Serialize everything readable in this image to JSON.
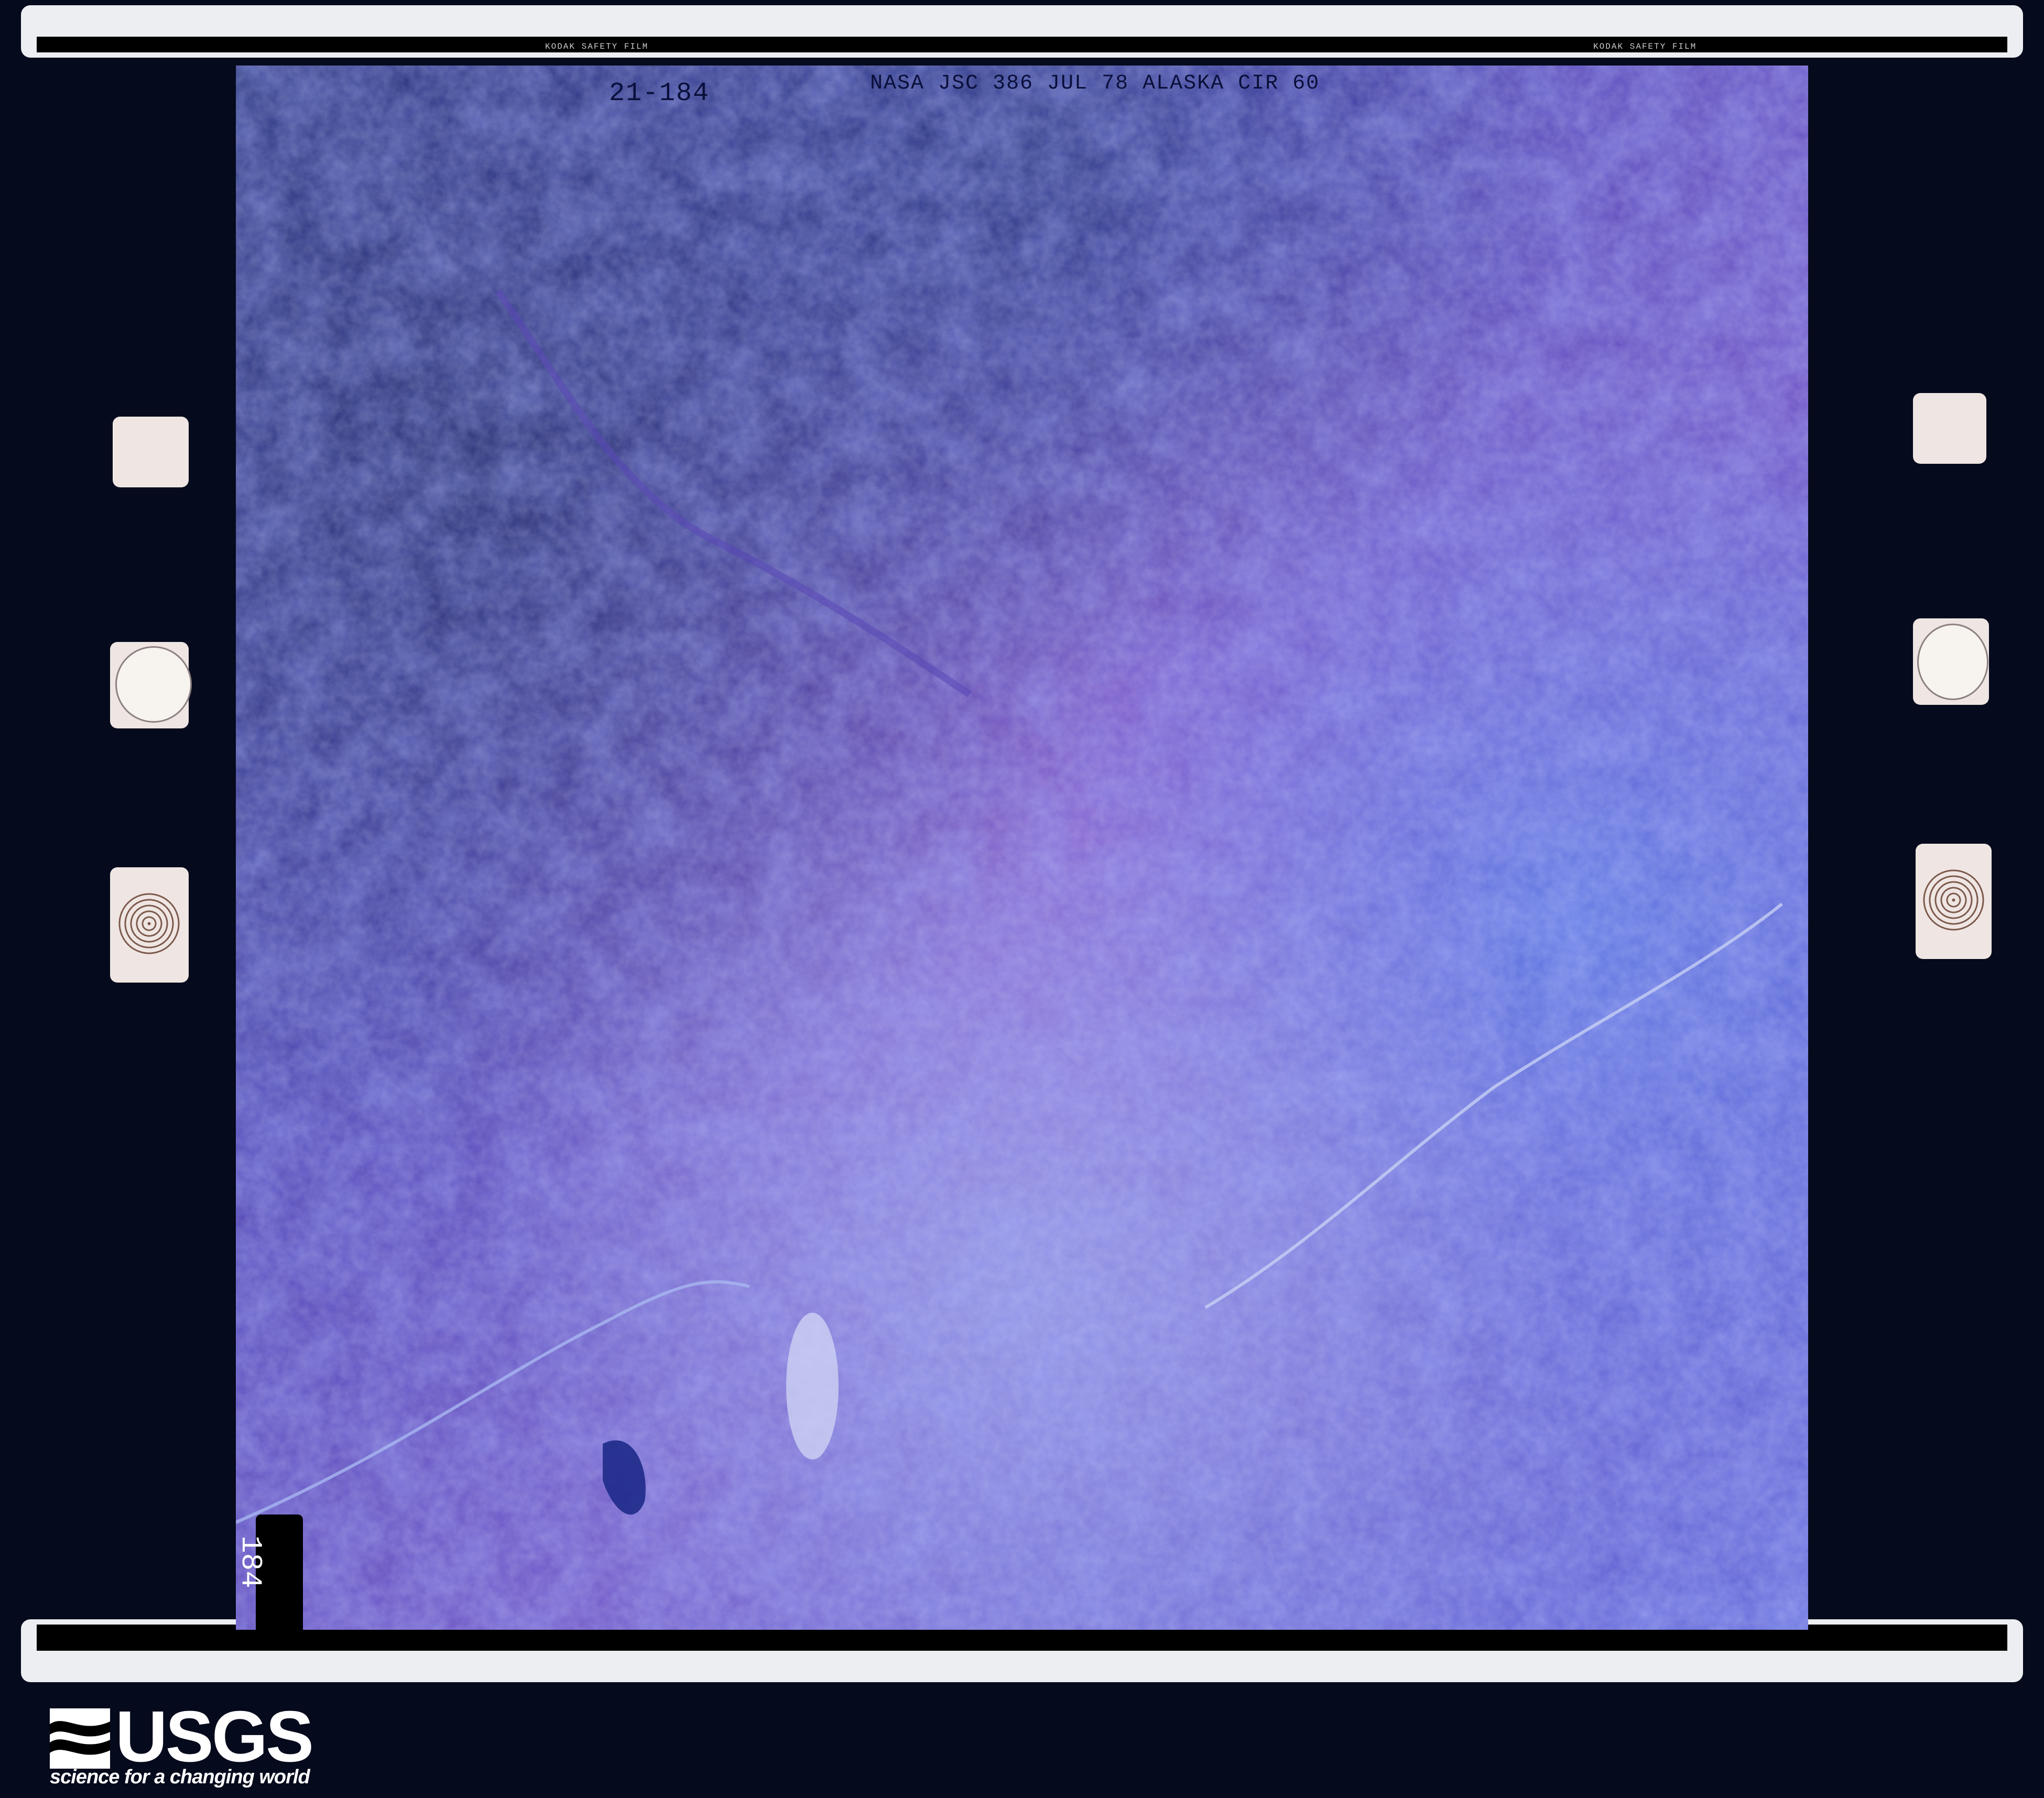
{
  "photo": {
    "frame_id": "21-184",
    "header": "NASA JSC 386 JUL 78 ALASKA CIR 60",
    "frame_number_corner": "184"
  },
  "film": {
    "edge_text": "KODAK SAFETY FILM"
  },
  "logo": {
    "wordmark": "USGS",
    "tagline": "science for a changing world"
  }
}
